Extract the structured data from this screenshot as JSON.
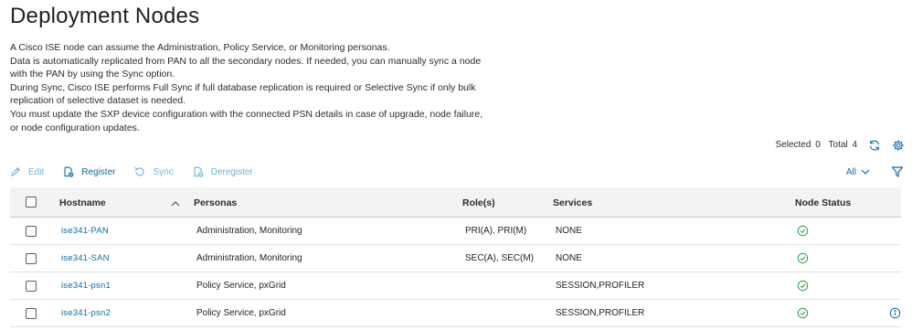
{
  "page": {
    "title": "Deployment Nodes",
    "description": [
      "A Cisco ISE node can assume the Administration, Policy Service, or Monitoring personas.",
      "Data is automatically replicated from PAN to all the secondary nodes. If needed, you can manually sync a node",
      "with the PAN by using the Sync option.",
      "During Sync, Cisco ISE performs Full Sync if full database replication is required or Selective Sync if only bulk",
      "replication of selective dataset is needed.",
      "You must update the SXP device configuration with the connected PSN details in case of upgrade, node failure,",
      "or node configuration updates."
    ]
  },
  "selection": {
    "selected_label": "Selected",
    "selected_count": "0",
    "total_label": "Total",
    "total_count": "4",
    "refresh_icon": "refresh-icon",
    "settings_icon": "gear-icon"
  },
  "toolbar": {
    "edit": "Edit",
    "register": "Register",
    "sync": "Sync",
    "deregister": "Deregister",
    "filter_value": "All",
    "filter_icon": "funnel-icon"
  },
  "table": {
    "headers": {
      "hostname": "Hostname",
      "personas": "Personas",
      "roles": "Role(s)",
      "services": "Services",
      "node_status": "Node Status"
    },
    "rows": [
      {
        "hostname": "ise341-PAN",
        "personas": "Administration, Monitoring",
        "roles": "PRI(A), PRI(M)",
        "services": "NONE",
        "status": "ok"
      },
      {
        "hostname": "ise341-SAN",
        "personas": "Administration, Monitoring",
        "roles": "SEC(A), SEC(M)",
        "services": "NONE",
        "status": "ok"
      },
      {
        "hostname": "ise341-psn1",
        "personas": "Policy Service, pxGrid",
        "roles": "",
        "services": "SESSION,PROFILER",
        "status": "ok"
      },
      {
        "hostname": "ise341-psn2",
        "personas": "Policy Service, pxGrid",
        "roles": "",
        "services": "SESSION,PROFILER",
        "status": "ok"
      }
    ]
  },
  "colors": {
    "link": "#0a6fa8",
    "disabled_link": "#6fb3d6",
    "status_ok": "#2e9e4f",
    "header_bg": "#f2f3f3"
  }
}
